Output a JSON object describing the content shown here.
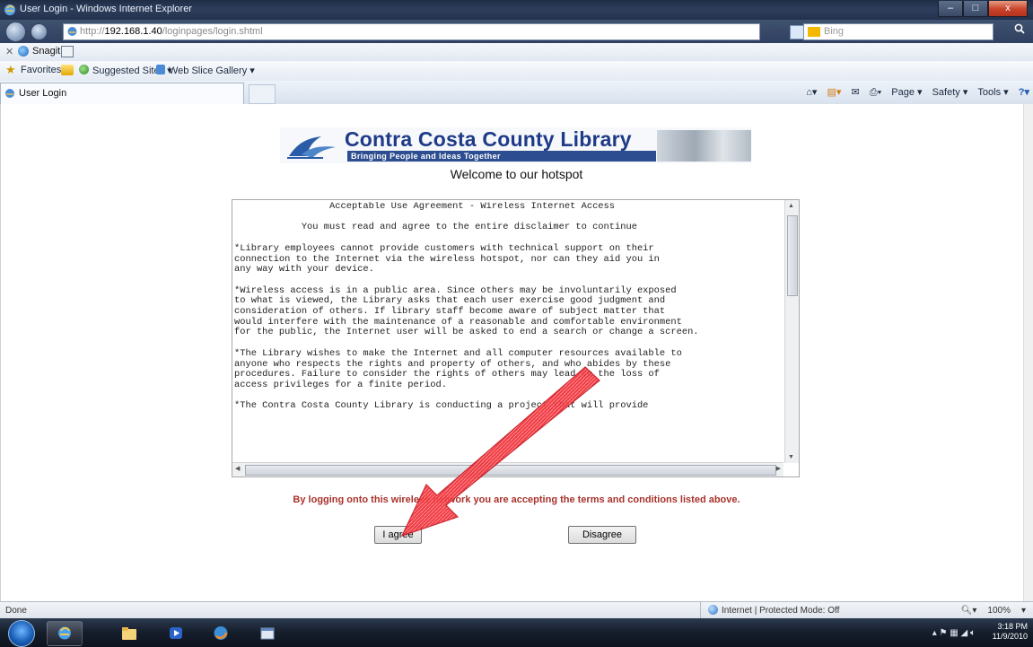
{
  "window": {
    "title": "User Login - Windows Internet Explorer",
    "controls": [
      "–",
      "□",
      "x"
    ]
  },
  "address_bar": {
    "protocol": "http://",
    "host": "192.168.1.40",
    "path": "/loginpages/login.shtml",
    "search_placeholder": "Bing",
    "search_icon": "magnifier-icon"
  },
  "toolbars": {
    "snagit_label": "Snagit",
    "favorites_label": "Favorites",
    "suggested_sites": "Suggested Sites ▾",
    "web_slice_gallery": "Web Slice Gallery ▾",
    "commands": [
      "Page ▾",
      "Safety ▾",
      "Tools ▾"
    ]
  },
  "tab": {
    "label": "User Login"
  },
  "page": {
    "banner": {
      "name": "Contra Costa County Library",
      "tagline": "Bringing People and Ideas Together"
    },
    "welcome": "Welcome to our hotspot",
    "agreement_lines": [
      "                 Acceptable Use Agreement - Wireless Internet Access",
      "",
      "            You must read and agree to the entire disclaimer to continue",
      "",
      "*Library employees cannot provide customers with technical support on their",
      "connection to the Internet via the wireless hotspot, nor can they aid you in",
      "any way with your device.",
      "",
      "*Wireless access is in a public area. Since others may be involuntarily exposed",
      "to what is viewed, the Library asks that each user exercise good judgment and",
      "consideration of others. If library staff become aware of subject matter that",
      "would interfere with the maintenance of a reasonable and comfortable environment",
      "for the public, the Internet user will be asked to end a search or change a screen.",
      "",
      "*The Library wishes to make the Internet and all computer resources available to",
      "anyone who respects the rights and property of others, and who abides by these",
      "procedures. Failure to consider the rights of others may lead to the loss of",
      "access privileges for a finite period.",
      "",
      "*The Contra Costa County Library is conducting a project that will provide"
    ],
    "notice": "By logging onto this wireless network you are accepting the terms and conditions listed above.",
    "agree_button": "I agree",
    "disagree_button": "Disagree"
  },
  "status_bar": {
    "left": "Done",
    "zone": "Internet | Protected Mode: Off",
    "zoom": "100%"
  },
  "taskbar": {
    "time": "3:18 PM",
    "date": "11/9/2010",
    "pinned": [
      "ie-icon",
      "explorer-icon",
      "media-player-icon",
      "firefox-icon",
      "app-window-icon"
    ]
  },
  "colors": {
    "notice_red": "#a8322b",
    "banner_blue": "#1e3a88",
    "arrow_red": "#e8202a"
  }
}
